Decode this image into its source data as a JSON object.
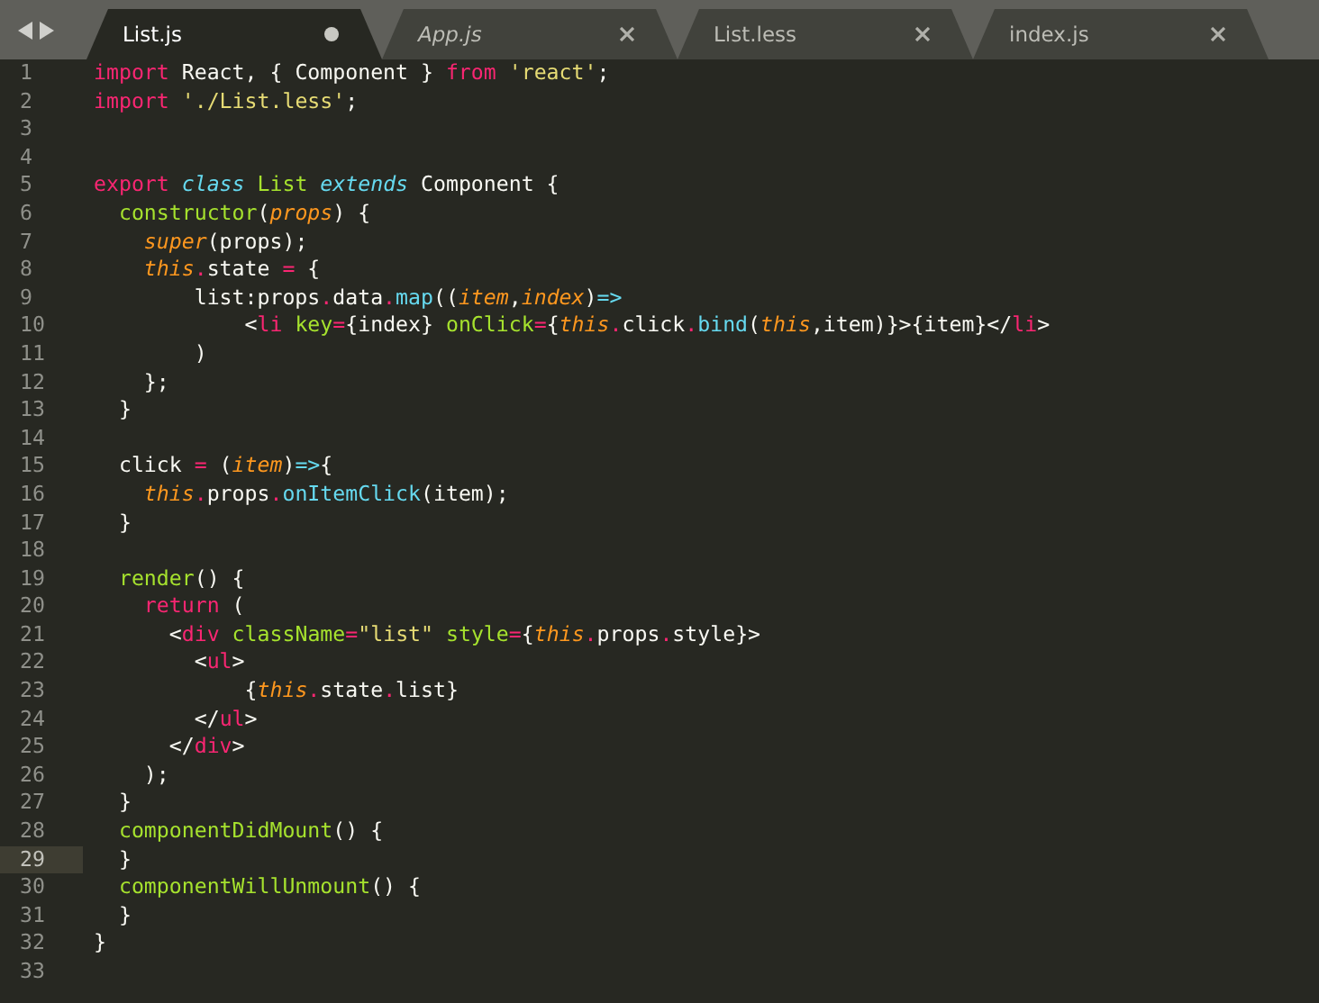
{
  "tabs": [
    {
      "label": "List.js",
      "selected": true,
      "modified": true,
      "preview": false
    },
    {
      "label": "App.js",
      "selected": false,
      "modified": false,
      "preview": true
    },
    {
      "label": "List.less",
      "selected": false,
      "modified": false,
      "preview": false
    },
    {
      "label": "index.js",
      "selected": false,
      "modified": false,
      "preview": false
    }
  ],
  "lines": [
    {
      "number": "1",
      "current": false,
      "tokens": [
        {
          "text": "import",
          "kind": "keyword"
        },
        {
          "text": " React, { Component } ",
          "kind": "plain"
        },
        {
          "text": "from",
          "kind": "keyword"
        },
        {
          "text": " 'react'",
          "kind": "string"
        },
        {
          "text": ";",
          "kind": "plain"
        }
      ]
    },
    {
      "number": "2",
      "current": false,
      "tokens": [
        {
          "text": "import",
          "kind": "keyword"
        },
        {
          "text": " './List.less'",
          "kind": "string"
        },
        {
          "text": ";",
          "kind": "plain"
        }
      ]
    },
    {
      "number": "3",
      "current": false
    },
    {
      "number": "4",
      "current": false
    },
    {
      "number": "5",
      "current": false,
      "tokens": [
        {
          "text": "export",
          "kind": "keyword"
        },
        {
          "text": " class",
          "kind": "storage"
        },
        {
          "text": " List",
          "kind": "entity"
        },
        {
          "text": " extends",
          "kind": "storage"
        },
        {
          "text": " Component {",
          "kind": "plain"
        }
      ]
    },
    {
      "number": "6",
      "current": false,
      "tokens": [
        {
          "text": "  constructor",
          "kind": "entity"
        },
        {
          "text": "(",
          "kind": "plain"
        },
        {
          "text": "props",
          "kind": "param"
        },
        {
          "text": ") {",
          "kind": "plain"
        }
      ]
    },
    {
      "number": "7",
      "current": false,
      "tokens": [
        {
          "text": "    super",
          "kind": "param"
        },
        {
          "text": "(props);",
          "kind": "plain"
        }
      ]
    },
    {
      "number": "8",
      "current": false,
      "tokens": [
        {
          "text": "    this",
          "kind": "param"
        },
        {
          "text": ".",
          "kind": "keyword"
        },
        {
          "text": "state ",
          "kind": "plain"
        },
        {
          "text": "=",
          "kind": "keyword"
        },
        {
          "text": " {",
          "kind": "plain"
        }
      ]
    },
    {
      "number": "9",
      "current": false,
      "tokens": [
        {
          "text": "        list:props",
          "kind": "plain"
        },
        {
          "text": ".",
          "kind": "keyword"
        },
        {
          "text": "data",
          "kind": "plain"
        },
        {
          "text": ".",
          "kind": "keyword"
        },
        {
          "text": "map",
          "kind": "support"
        },
        {
          "text": "((",
          "kind": "plain"
        },
        {
          "text": "item",
          "kind": "param"
        },
        {
          "text": ",",
          "kind": "plain"
        },
        {
          "text": "index",
          "kind": "param"
        },
        {
          "text": ")",
          "kind": "plain"
        },
        {
          "text": "=>",
          "kind": "support"
        }
      ]
    },
    {
      "number": "10",
      "current": false,
      "tokens": [
        {
          "text": "            <",
          "kind": "plain"
        },
        {
          "text": "li",
          "kind": "keyword"
        },
        {
          "text": " key",
          "kind": "entity"
        },
        {
          "text": "=",
          "kind": "keyword"
        },
        {
          "text": "{index} ",
          "kind": "plain"
        },
        {
          "text": "onClick",
          "kind": "entity"
        },
        {
          "text": "=",
          "kind": "keyword"
        },
        {
          "text": "{",
          "kind": "plain"
        },
        {
          "text": "this",
          "kind": "param"
        },
        {
          "text": ".",
          "kind": "keyword"
        },
        {
          "text": "click",
          "kind": "plain"
        },
        {
          "text": ".",
          "kind": "keyword"
        },
        {
          "text": "bind",
          "kind": "support"
        },
        {
          "text": "(",
          "kind": "plain"
        },
        {
          "text": "this",
          "kind": "param"
        },
        {
          "text": ",item)}>{item}</",
          "kind": "plain"
        },
        {
          "text": "li",
          "kind": "keyword"
        },
        {
          "text": ">",
          "kind": "plain"
        }
      ]
    },
    {
      "number": "11",
      "current": false,
      "tokens": [
        {
          "text": "        )",
          "kind": "plain"
        }
      ]
    },
    {
      "number": "12",
      "current": false,
      "tokens": [
        {
          "text": "    };",
          "kind": "plain"
        }
      ]
    },
    {
      "number": "13",
      "current": false,
      "tokens": [
        {
          "text": "  }",
          "kind": "plain"
        }
      ]
    },
    {
      "number": "14",
      "current": false
    },
    {
      "number": "15",
      "current": false,
      "tokens": [
        {
          "text": "  click ",
          "kind": "plain"
        },
        {
          "text": "=",
          "kind": "keyword"
        },
        {
          "text": " (",
          "kind": "plain"
        },
        {
          "text": "item",
          "kind": "param"
        },
        {
          "text": ")",
          "kind": "plain"
        },
        {
          "text": "=>",
          "kind": "support"
        },
        {
          "text": "{",
          "kind": "plain"
        }
      ]
    },
    {
      "number": "16",
      "current": false,
      "tokens": [
        {
          "text": "    this",
          "kind": "param"
        },
        {
          "text": ".",
          "kind": "keyword"
        },
        {
          "text": "props",
          "kind": "plain"
        },
        {
          "text": ".",
          "kind": "keyword"
        },
        {
          "text": "onItemClick",
          "kind": "support"
        },
        {
          "text": "(item);",
          "kind": "plain"
        }
      ]
    },
    {
      "number": "17",
      "current": false,
      "tokens": [
        {
          "text": "  }",
          "kind": "plain"
        }
      ]
    },
    {
      "number": "18",
      "current": false
    },
    {
      "number": "19",
      "current": false,
      "tokens": [
        {
          "text": "  render",
          "kind": "entity"
        },
        {
          "text": "() {",
          "kind": "plain"
        }
      ]
    },
    {
      "number": "20",
      "current": false,
      "tokens": [
        {
          "text": "    return",
          "kind": "keyword"
        },
        {
          "text": " (",
          "kind": "plain"
        }
      ]
    },
    {
      "number": "21",
      "current": false,
      "tokens": [
        {
          "text": "      <",
          "kind": "plain"
        },
        {
          "text": "div",
          "kind": "keyword"
        },
        {
          "text": " className",
          "kind": "entity"
        },
        {
          "text": "=",
          "kind": "keyword"
        },
        {
          "text": "\"list\"",
          "kind": "string"
        },
        {
          "text": " style",
          "kind": "entity"
        },
        {
          "text": "=",
          "kind": "keyword"
        },
        {
          "text": "{",
          "kind": "plain"
        },
        {
          "text": "this",
          "kind": "param"
        },
        {
          "text": ".",
          "kind": "keyword"
        },
        {
          "text": "props",
          "kind": "plain"
        },
        {
          "text": ".",
          "kind": "keyword"
        },
        {
          "text": "style}>",
          "kind": "plain"
        }
      ]
    },
    {
      "number": "22",
      "current": false,
      "tokens": [
        {
          "text": "        <",
          "kind": "plain"
        },
        {
          "text": "ul",
          "kind": "keyword"
        },
        {
          "text": ">",
          "kind": "plain"
        }
      ]
    },
    {
      "number": "23",
      "current": false,
      "tokens": [
        {
          "text": "            {",
          "kind": "plain"
        },
        {
          "text": "this",
          "kind": "param"
        },
        {
          "text": ".",
          "kind": "keyword"
        },
        {
          "text": "state",
          "kind": "plain"
        },
        {
          "text": ".",
          "kind": "keyword"
        },
        {
          "text": "list}",
          "kind": "plain"
        }
      ]
    },
    {
      "number": "24",
      "current": false,
      "tokens": [
        {
          "text": "        </",
          "kind": "plain"
        },
        {
          "text": "ul",
          "kind": "keyword"
        },
        {
          "text": ">",
          "kind": "plain"
        }
      ]
    },
    {
      "number": "25",
      "current": false,
      "tokens": [
        {
          "text": "      </",
          "kind": "plain"
        },
        {
          "text": "div",
          "kind": "keyword"
        },
        {
          "text": ">",
          "kind": "plain"
        }
      ]
    },
    {
      "number": "26",
      "current": false,
      "tokens": [
        {
          "text": "    );",
          "kind": "plain"
        }
      ]
    },
    {
      "number": "27",
      "current": false,
      "tokens": [
        {
          "text": "  }",
          "kind": "plain"
        }
      ]
    },
    {
      "number": "28",
      "current": false,
      "tokens": [
        {
          "text": "  componentDidMount",
          "kind": "entity"
        },
        {
          "text": "() {",
          "kind": "plain"
        }
      ]
    },
    {
      "number": "29",
      "current": true,
      "tokens": [
        {
          "text": "  }",
          "kind": "plain"
        }
      ]
    },
    {
      "number": "30",
      "current": false,
      "tokens": [
        {
          "text": "  componentWillUnmount",
          "kind": "entity"
        },
        {
          "text": "() {",
          "kind": "plain"
        }
      ]
    },
    {
      "number": "31",
      "current": false,
      "tokens": [
        {
          "text": "  }",
          "kind": "plain"
        }
      ]
    },
    {
      "number": "32",
      "current": false,
      "tokens": [
        {
          "text": "}",
          "kind": "plain"
        }
      ]
    },
    {
      "number": "33",
      "current": false
    }
  ]
}
